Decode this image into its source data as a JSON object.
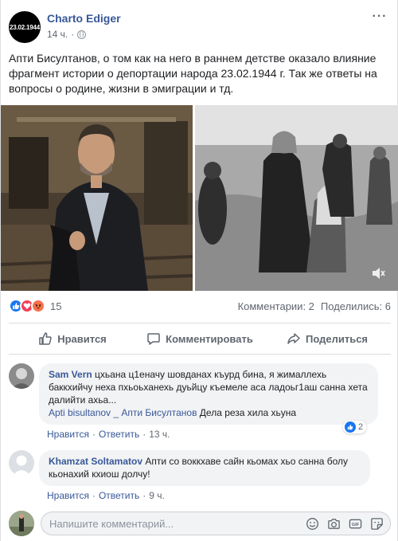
{
  "post": {
    "author": "Charto Ediger",
    "avatar_text": "23.02.1944",
    "time": "14 ч.",
    "more_label": "···",
    "text": "Апти Бисултанов, о том как на него в раннем детстве оказало влияние фрагмент истории о депортации народа 23.02.1944 г. Так же ответы на вопросы о родине, жизни в эмиграции и тд."
  },
  "stats": {
    "reaction_count": "15",
    "comments": "Комментарии: 2",
    "shares": "Поделились: 6"
  },
  "actions": {
    "like": "Нравится",
    "comment": "Комментировать",
    "share": "Поделиться"
  },
  "comments": [
    {
      "name": "Sam Vern",
      "text": "цхьана ц1еначу шовданах къурд бина, я жималлехь баккхийчу неха пхьоьханехь дуьйцу къемеле аса ладоьг1аш санна хета далийти ахьа...",
      "reply_tag": "Apti bisultanov _ Апти Бисултанов",
      "reply_text": "Дела реза хила хьуна",
      "like": "Нравится",
      "reply": "Ответить",
      "time": "13 ч.",
      "like_count": "2",
      "sep": "·"
    },
    {
      "name": "Khamzat Soltamatov",
      "text": "Апти со воккхаве сайн кьомах хьо санна болу кьонахий кхиош долчу!",
      "like": "Нравится",
      "reply": "Ответить",
      "time": "9 ч.",
      "sep": "·"
    }
  ],
  "composer": {
    "placeholder": "Напишите комментарий..."
  },
  "colors": {
    "link": "#385898",
    "like_blue": "#1877f2",
    "love_red": "#f33e58",
    "angry_orange": "#f7714b",
    "bubble_bg": "#f2f3f5"
  }
}
